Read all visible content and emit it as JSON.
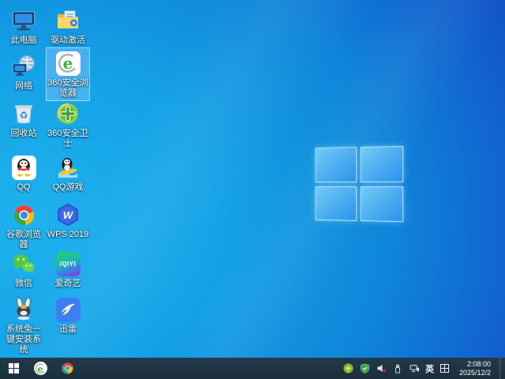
{
  "colors": {
    "wallpaper_light": "#1fb2ee",
    "wallpaper_deep": "#1b40c3",
    "taskbar_bg": "#1e3442",
    "selection_fill": "rgba(140,200,255,0.42)",
    "selection_border": "rgba(205,235,255,0.65)",
    "accent_green": "#3faf3c"
  },
  "desktop": {
    "icons": [
      {
        "name": "this-pc",
        "label": "此电脑",
        "selected": false
      },
      {
        "name": "driver-activation",
        "label": "驱动激活",
        "selected": false
      },
      {
        "name": "network",
        "label": "网络",
        "selected": false
      },
      {
        "name": "360-safe-browser",
        "label": "360安全浏览器",
        "selected": true
      },
      {
        "name": "recycle-bin",
        "label": "回收站",
        "selected": false
      },
      {
        "name": "360-security-guard",
        "label": "360安全卫士",
        "selected": false
      },
      {
        "name": "qq",
        "label": "QQ",
        "selected": false
      },
      {
        "name": "qq-games",
        "label": "QQ游戏",
        "selected": false
      },
      {
        "name": "google-chrome",
        "label": "谷歌浏览器",
        "selected": false
      },
      {
        "name": "wps-2019",
        "label": "WPS 2019",
        "selected": false
      },
      {
        "name": "wechat",
        "label": "微信",
        "selected": false
      },
      {
        "name": "iqiyi",
        "label": "爱奇艺",
        "selected": false
      },
      {
        "name": "system-rabbit-installer",
        "label": "系统兔一键安装系统",
        "selected": false
      },
      {
        "name": "thunder",
        "label": "迅雷",
        "selected": false
      }
    ]
  },
  "icon_art": {
    "browser_letter": "e",
    "wps_letter": "W",
    "iqiyi_text": "iQIYI",
    "recycle_glyph": "♻"
  },
  "taskbar": {
    "pinned_icons": [
      "start",
      "360-safe-browser",
      "google-chrome"
    ],
    "tray": {
      "icons": [
        "360-antivirus",
        "security-shield",
        "volume-muted",
        "usb-device",
        "network-connection",
        "ime-input"
      ],
      "language": "英",
      "time": "2:08:00",
      "date": "2025/12/2"
    }
  }
}
